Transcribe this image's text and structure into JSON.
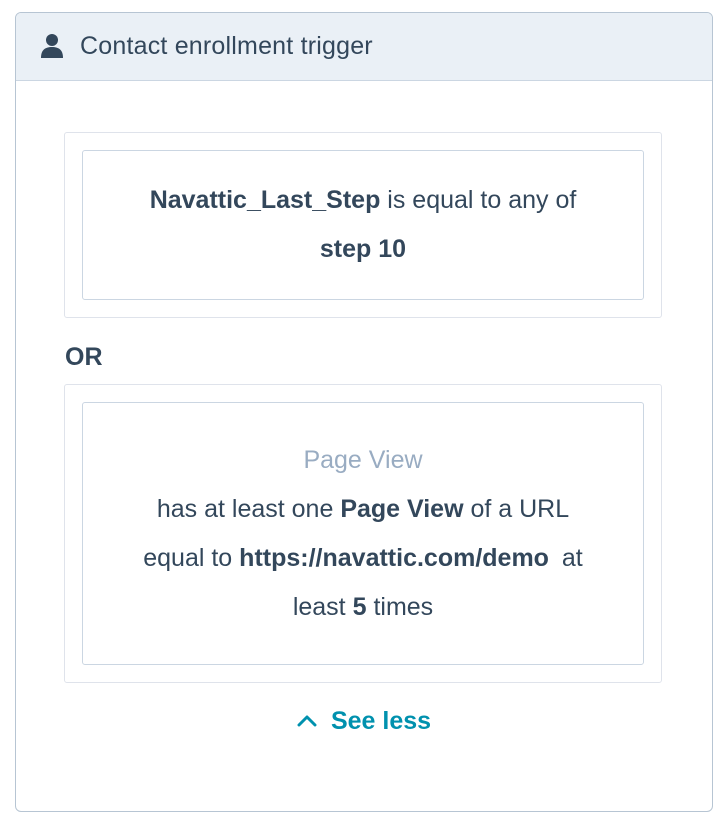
{
  "header": {
    "icon": "person-icon",
    "title": "Contact enrollment trigger"
  },
  "filters": [
    {
      "property": "Navattic_Last_Step",
      "operator": "is equal to any of",
      "value": "step 10"
    },
    {
      "type_label": "Page View",
      "text_before": "has at least one",
      "event": "Page View",
      "text_mid": "of a URL",
      "text_equal": "equal to",
      "url": "https://navattic.com/demo",
      "text_at": "at",
      "text_least": "least",
      "count": "5",
      "text_times": "times"
    }
  ],
  "or_label": "OR",
  "see_less": {
    "icon": "chevron-up-icon",
    "label": "See less"
  },
  "colors": {
    "text": "#33475b",
    "muted": "#99acc2",
    "link": "#0091ae",
    "header_bg": "#eaf0f6",
    "border": "#cbd6e2"
  }
}
